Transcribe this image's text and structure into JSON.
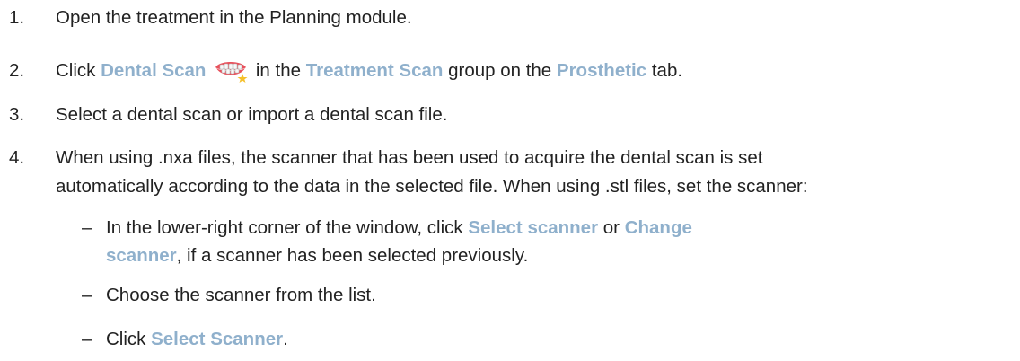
{
  "steps": [
    {
      "number": "1.",
      "text": "Open the treatment in the Planning module."
    },
    {
      "number": "2.",
      "pre": "Click ",
      "link1": "Dental Scan",
      "icon": "dental-scan-icon",
      "mid1": " in the ",
      "link2": "Treatment Scan",
      "mid2": " group on the ",
      "link3": "Prosthetic",
      "post": " tab."
    },
    {
      "number": "3.",
      "text": "Select a dental scan or import a dental scan file."
    },
    {
      "number": "4.",
      "line1": "When using .nxa files, the scanner that has been used to acquire the dental scan is set",
      "line2": "automatically according to the data in the selected file. When using .stl files, set the scanner:",
      "subs": [
        {
          "dash": "–",
          "pre": "In the lower-right corner of the window, click ",
          "link1": "Select scanner",
          "mid": " or ",
          "link2a": "Change",
          "link2b": "scanner",
          "post": ", if a scanner has been selected previously."
        },
        {
          "dash": "–",
          "text": "Choose the scanner from the list."
        },
        {
          "dash": "–",
          "pre": "Click ",
          "link": "Select Scanner",
          "post": "."
        }
      ]
    }
  ],
  "colors": {
    "text": "#222222",
    "link": "#8fb0cc"
  }
}
